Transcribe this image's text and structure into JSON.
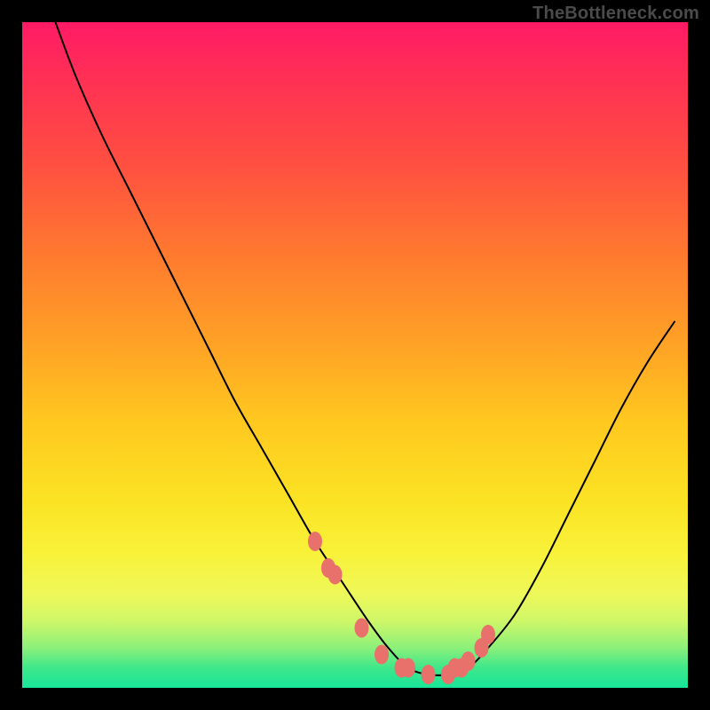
{
  "watermark": "TheBottleneck.com",
  "colors": {
    "background": "#000000",
    "curve": "#000000",
    "markers": "#e9716b",
    "gradient_stops": [
      "#ff1a66",
      "#ff2f55",
      "#ff5140",
      "#ff7a2f",
      "#ffa126",
      "#ffc81f",
      "#fbe324",
      "#f8f23a",
      "#eef85a",
      "#cef768",
      "#8bf07a",
      "#3fe78b",
      "#17e699"
    ]
  },
  "chart_data": {
    "type": "line",
    "title": "",
    "xlabel": "",
    "ylabel": "",
    "xlim": [
      0,
      100
    ],
    "ylim": [
      0,
      100
    ],
    "grid": false,
    "legend": null,
    "series": [
      {
        "name": "bottleneck-curve",
        "x": [
          5,
          8,
          12,
          16,
          20,
          24,
          28,
          32,
          36,
          40,
          44,
          48,
          52,
          55,
          58,
          61,
          64,
          67,
          70,
          74,
          78,
          82,
          86,
          90,
          94,
          98
        ],
        "values": [
          100,
          92,
          83,
          75,
          67,
          59,
          51,
          43,
          36,
          29,
          22,
          16,
          10,
          6,
          3,
          2,
          2,
          3,
          6,
          11,
          18,
          26,
          34,
          42,
          49,
          55
        ]
      }
    ],
    "highlighted_points": {
      "name": "marker-cluster",
      "x": [
        44,
        46,
        47,
        51,
        54,
        57,
        58,
        61,
        64,
        65,
        66,
        67,
        69,
        70
      ],
      "values": [
        22,
        18,
        17,
        9,
        5,
        3,
        3,
        2,
        2,
        3,
        3,
        4,
        6,
        8
      ]
    },
    "annotations": []
  }
}
